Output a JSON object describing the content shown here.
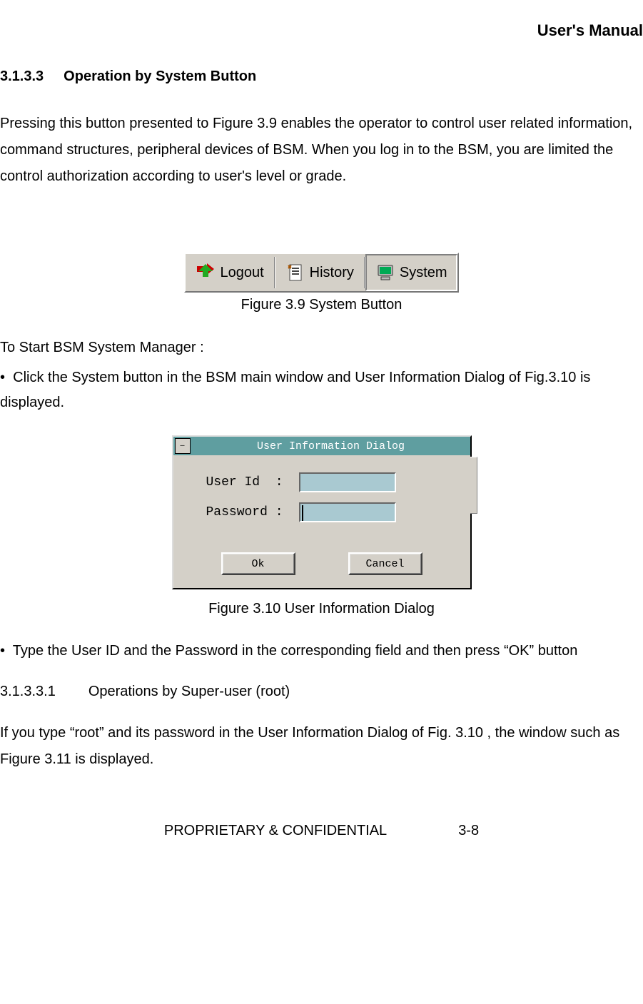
{
  "header": {
    "title": "User's Manual"
  },
  "section": {
    "number": "3.1.3.3",
    "title": "Operation by System Button"
  },
  "para1": "Pressing this button presented to Figure 3.9 enables the operator to control user related information, command structures, peripheral devices of BSM. When you log in to the BSM, you are limited the control authorization according to user's level or grade.",
  "toolbar": {
    "logout": "Logout",
    "history": "History",
    "system": "System"
  },
  "caption1": "Figure 3.9 System Button",
  "instructions_intro": "To Start BSM System Manager :",
  "bullet1": "Click the System button in the BSM main window and User Information Dialog of Fig.3.10 is displayed.",
  "dialog": {
    "title": "User Information Dialog",
    "user_label": "User Id  :",
    "pass_label": "Password :",
    "user_value": "",
    "pass_value": "",
    "ok": "Ok",
    "cancel": "Cancel"
  },
  "caption2": "Figure 3.10 User Information Dialog",
  "bullet2": "Type the User ID and the Password in the corresponding field and then press “OK” button",
  "subsub": {
    "number": "3.1.3.3.1",
    "title": "Operations by Super-user (root)"
  },
  "para2": "If you type “root” and its password in the User Information Dialog of Fig. 3.10 , the window such as Figure 3.11 is displayed.",
  "footer": {
    "confidential": "PROPRIETARY & CONFIDENTIAL",
    "page": "3-8"
  }
}
